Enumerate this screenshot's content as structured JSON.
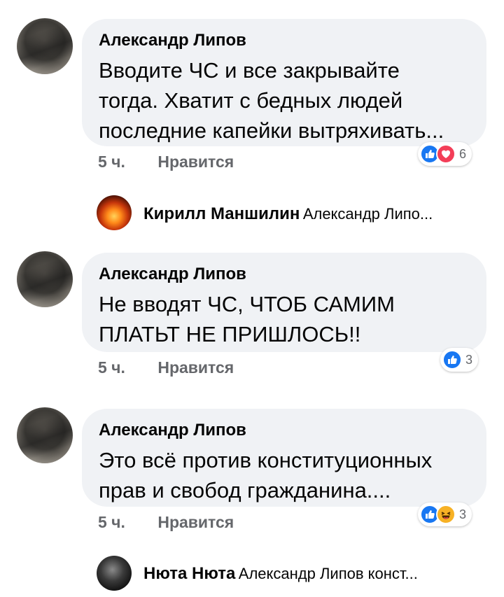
{
  "comments": [
    {
      "author": "Александр Липов",
      "lines": [
        "Вводите ЧС и все закрывайте",
        "тогда. Хватит с бедных людей",
        "последние капейки вытряхивать..."
      ],
      "time": "5 ч.",
      "like_label": "Нравится",
      "reactions": [
        "like",
        "love"
      ],
      "reaction_count": "6"
    },
    {
      "author": "Александр Липов",
      "lines": [
        "Не вводят ЧС, ЧТОБ САМИМ",
        "ПЛАТЬТ НЕ ПРИШЛОСЬ!!"
      ],
      "time": "5 ч.",
      "like_label": "Нравится",
      "reactions": [
        "like"
      ],
      "reaction_count": "3"
    },
    {
      "author": "Александр Липов",
      "lines": [
        "Это всё против конституционных",
        "прав и свобод гражданина...."
      ],
      "time": "5 ч.",
      "like_label": "Нравится",
      "reactions": [
        "like",
        "haha"
      ],
      "reaction_count": "3"
    }
  ],
  "replies": [
    {
      "author": "Кирилл Маншилин",
      "preview": "Александр Липо..."
    },
    {
      "author": "Нюта Нюта",
      "preview": "Александр Липов конст..."
    }
  ],
  "colors": {
    "bubble": "#f0f2f5",
    "like": "#1877f2",
    "love": "#f33e58",
    "haha": "#f7b125",
    "meta": "#65676b"
  }
}
